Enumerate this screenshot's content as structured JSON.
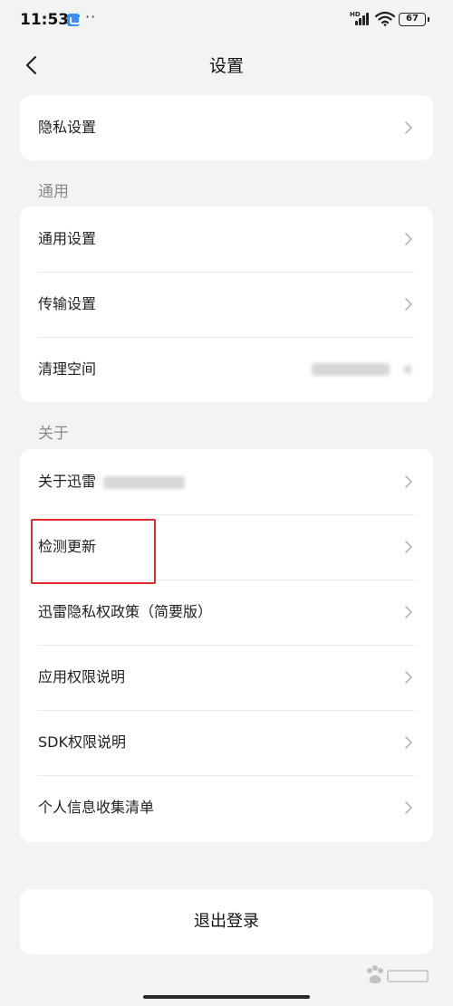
{
  "status_bar": {
    "time": "11:53",
    "dots": "··",
    "hd": "HD",
    "battery": "67",
    "icons": [
      "app-notification-icon",
      "signal-icon",
      "wifi-icon",
      "battery-icon"
    ]
  },
  "nav": {
    "title": "设置",
    "back_icon": "chevron-left-icon"
  },
  "top_card": {
    "items": [
      {
        "label": "隐私设置"
      }
    ]
  },
  "general": {
    "header": "通用",
    "items": [
      {
        "label": "通用设置"
      },
      {
        "label": "传输设置"
      },
      {
        "label": "清理空间"
      }
    ]
  },
  "about": {
    "header": "关于",
    "items": [
      {
        "label": "关于迅雷"
      },
      {
        "label": "检测更新"
      },
      {
        "label": "迅雷隐私权政策（简要版）"
      },
      {
        "label": "应用权限说明"
      },
      {
        "label": "SDK权限说明"
      },
      {
        "label": "个人信息收集清单"
      }
    ]
  },
  "logout": {
    "label": "退出登录"
  },
  "colors": {
    "background": "#f2f3f5",
    "card": "#ffffff",
    "section_header": "#8a8a8a",
    "highlight": "#e02b2b"
  }
}
